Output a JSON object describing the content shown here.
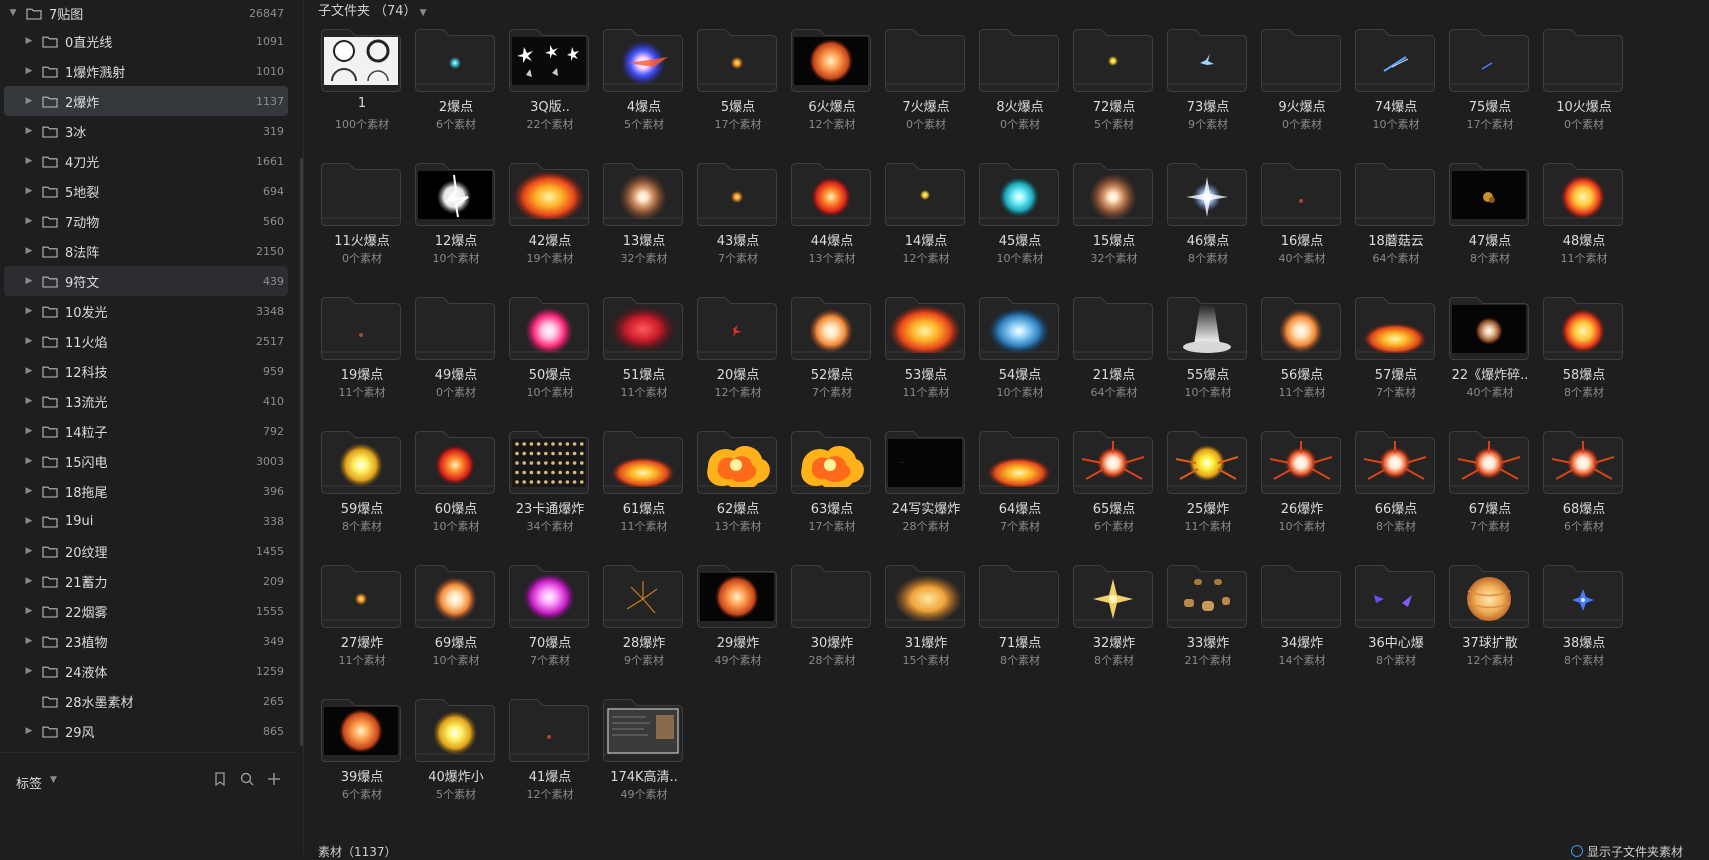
{
  "sidebar": {
    "root": {
      "label": "7贴图",
      "count": "26847"
    },
    "items": [
      {
        "label": "0直光线",
        "count": "1091"
      },
      {
        "label": "1爆炸溅射",
        "count": "1010"
      },
      {
        "label": "2爆炸",
        "count": "1137",
        "selected": true
      },
      {
        "label": "3冰",
        "count": "319"
      },
      {
        "label": "4刀光",
        "count": "1661"
      },
      {
        "label": "5地裂",
        "count": "694"
      },
      {
        "label": "7动物",
        "count": "560"
      },
      {
        "label": "8法阵",
        "count": "2150"
      },
      {
        "label": "9符文",
        "count": "439",
        "hover": true
      },
      {
        "label": "10发光",
        "count": "3348"
      },
      {
        "label": "11火焰",
        "count": "2517"
      },
      {
        "label": "12科技",
        "count": "959"
      },
      {
        "label": "13流光",
        "count": "410"
      },
      {
        "label": "14粒子",
        "count": "792"
      },
      {
        "label": "15闪电",
        "count": "3003"
      },
      {
        "label": "18拖尾",
        "count": "396"
      },
      {
        "label": "19ui",
        "count": "338"
      },
      {
        "label": "20纹理",
        "count": "1455"
      },
      {
        "label": "21蓄力",
        "count": "209"
      },
      {
        "label": "22烟雾",
        "count": "1555"
      },
      {
        "label": "23植物",
        "count": "349"
      },
      {
        "label": "24液体",
        "count": "1259"
      },
      {
        "label": "28水墨素材",
        "count": "265",
        "no_caret": true
      },
      {
        "label": "29风",
        "count": "865"
      }
    ],
    "tags": {
      "label": "标签"
    }
  },
  "main": {
    "subfolder_label": "子文件夹",
    "subfolder_count": "（74）",
    "footer_left": "素材（1137）",
    "footer_right": "显示子文件夹素材"
  },
  "folders": [
    {
      "name": "1",
      "count": "100个素材",
      "fx": "sketch"
    },
    {
      "name": "2爆点",
      "count": "6个素材",
      "fx": "tiny-cyan"
    },
    {
      "name": "3Q版..",
      "count": "22个素材",
      "fx": "sparkle"
    },
    {
      "name": "4爆点",
      "count": "5个素材",
      "fx": "blue-burst"
    },
    {
      "name": "5爆点",
      "count": "17个素材",
      "fx": "tiny-orange"
    },
    {
      "name": "6火爆点",
      "count": "12个素材",
      "fx": "fire-dark"
    },
    {
      "name": "7火爆点",
      "count": "0个素材",
      "fx": "none"
    },
    {
      "name": "8火爆点",
      "count": "0个素材",
      "fx": "none"
    },
    {
      "name": "72爆点",
      "count": "5个素材",
      "fx": "tiny-yellow"
    },
    {
      "name": "73爆点",
      "count": "9个素材",
      "fx": "tiny-blue"
    },
    {
      "name": "9火爆点",
      "count": "0个素材",
      "fx": "none"
    },
    {
      "name": "74爆点",
      "count": "10个素材",
      "fx": "blue-streak"
    },
    {
      "name": "75爆点",
      "count": "17个素材",
      "fx": "blue-line"
    },
    {
      "name": "10火爆点",
      "count": "0个素材",
      "fx": "none"
    },
    {
      "name": "11火爆点",
      "count": "0个素材",
      "fx": "none"
    },
    {
      "name": "12爆点",
      "count": "10个素材",
      "fx": "white-blast"
    },
    {
      "name": "42爆点",
      "count": "19个素材",
      "fx": "fire-big"
    },
    {
      "name": "13爆点",
      "count": "32个素材",
      "fx": "soft-glow"
    },
    {
      "name": "43爆点",
      "count": "7个素材",
      "fx": "tiny-orange"
    },
    {
      "name": "44爆点",
      "count": "13个素材",
      "fx": "red-fire"
    },
    {
      "name": "14爆点",
      "count": "12个素材",
      "fx": "tiny-yellow"
    },
    {
      "name": "45爆点",
      "count": "10个素材",
      "fx": "teal-burst"
    },
    {
      "name": "15爆点",
      "count": "32个素材",
      "fx": "soft-glow"
    },
    {
      "name": "46爆点",
      "count": "8个素材",
      "fx": "white-star"
    },
    {
      "name": "16爆点",
      "count": "40个素材",
      "fx": "tiny-dark"
    },
    {
      "name": "18蘑菇云",
      "count": "64个素材",
      "fx": "none"
    },
    {
      "name": "47爆点",
      "count": "8个素材",
      "fx": "dark-small"
    },
    {
      "name": "48爆点",
      "count": "11个素材",
      "fx": "fire-ball"
    },
    {
      "name": "19爆点",
      "count": "11个素材",
      "fx": "tiny-dark"
    },
    {
      "name": "49爆点",
      "count": "0个素材",
      "fx": "none"
    },
    {
      "name": "50爆点",
      "count": "10个素材",
      "fx": "pink-burst"
    },
    {
      "name": "51爆点",
      "count": "11个素材",
      "fx": "red-smoke"
    },
    {
      "name": "20爆点",
      "count": "12个素材",
      "fx": "tiny-red"
    },
    {
      "name": "52爆点",
      "count": "7个素材",
      "fx": "orange-burst"
    },
    {
      "name": "53爆点",
      "count": "11个素材",
      "fx": "fire-big"
    },
    {
      "name": "54爆点",
      "count": "10个素材",
      "fx": "blue-smoke"
    },
    {
      "name": "21爆点",
      "count": "64个素材",
      "fx": "none"
    },
    {
      "name": "55爆点",
      "count": "10个素材",
      "fx": "light-beam"
    },
    {
      "name": "56爆点",
      "count": "11个素材",
      "fx": "orange-burst"
    },
    {
      "name": "57爆点",
      "count": "7个素材",
      "fx": "fire-ground"
    },
    {
      "name": "22《爆炸碎..",
      "count": "40个素材",
      "fx": "dark-debris"
    },
    {
      "name": "58爆点",
      "count": "8个素材",
      "fx": "fire-ball"
    },
    {
      "name": "59爆点",
      "count": "8个素材",
      "fx": "yellow-burst"
    },
    {
      "name": "60爆点",
      "count": "10个素材",
      "fx": "red-fire"
    },
    {
      "name": "23卡通爆炸",
      "count": "34个素材",
      "fx": "grid-dots"
    },
    {
      "name": "61爆点",
      "count": "11个素材",
      "fx": "fire-ground"
    },
    {
      "name": "62爆点",
      "count": "13个素材",
      "fx": "cartoon"
    },
    {
      "name": "63爆点",
      "count": "17个素材",
      "fx": "cartoon"
    },
    {
      "name": "24写实爆炸",
      "count": "28个素材",
      "fx": "dark-panel"
    },
    {
      "name": "64爆点",
      "count": "7个素材",
      "fx": "fire-ground"
    },
    {
      "name": "65爆点",
      "count": "6个素材",
      "fx": "splash-red"
    },
    {
      "name": "25爆炸",
      "count": "11个素材",
      "fx": "yellow-splash"
    },
    {
      "name": "26爆炸",
      "count": "10个素材",
      "fx": "splash-red"
    },
    {
      "name": "66爆点",
      "count": "8个素材",
      "fx": "splash-red"
    },
    {
      "name": "67爆点",
      "count": "7个素材",
      "fx": "splash-red"
    },
    {
      "name": "68爆点",
      "count": "6个素材",
      "fx": "splash-red"
    },
    {
      "name": "27爆炸",
      "count": "11个素材",
      "fx": "tiny-orange"
    },
    {
      "name": "69爆点",
      "count": "10个素材",
      "fx": "orange-burst"
    },
    {
      "name": "70爆点",
      "count": "7个素材",
      "fx": "purple-fire"
    },
    {
      "name": "28爆炸",
      "count": "9个素材",
      "fx": "sparks"
    },
    {
      "name": "29爆炸",
      "count": "49个素材",
      "fx": "fire-dark"
    },
    {
      "name": "30爆炸",
      "count": "28个素材",
      "fx": "none"
    },
    {
      "name": "31爆炸",
      "count": "15个素材",
      "fx": "cloud-orange"
    },
    {
      "name": "71爆点",
      "count": "8个素材",
      "fx": "none"
    },
    {
      "name": "32爆炸",
      "count": "8个素材",
      "fx": "gold-star"
    },
    {
      "name": "33爆炸",
      "count": "21个素材",
      "fx": "rocks"
    },
    {
      "name": "34爆炸",
      "count": "14个素材",
      "fx": "none"
    },
    {
      "name": "36中心爆",
      "count": "8个素材",
      "fx": "purple-streak"
    },
    {
      "name": "37球扩散",
      "count": "12个素材",
      "fx": "planet"
    },
    {
      "name": "38爆点",
      "count": "8个素材",
      "fx": "blue-star"
    },
    {
      "name": "39爆点",
      "count": "6个素材",
      "fx": "fire-dark"
    },
    {
      "name": "40爆炸小",
      "count": "5个素材",
      "fx": "yellow-burst"
    },
    {
      "name": "41爆点",
      "count": "12个素材",
      "fx": "tiny-dark"
    },
    {
      "name": "174K高清..",
      "count": "49个素材",
      "fx": "screenshot"
    }
  ]
}
